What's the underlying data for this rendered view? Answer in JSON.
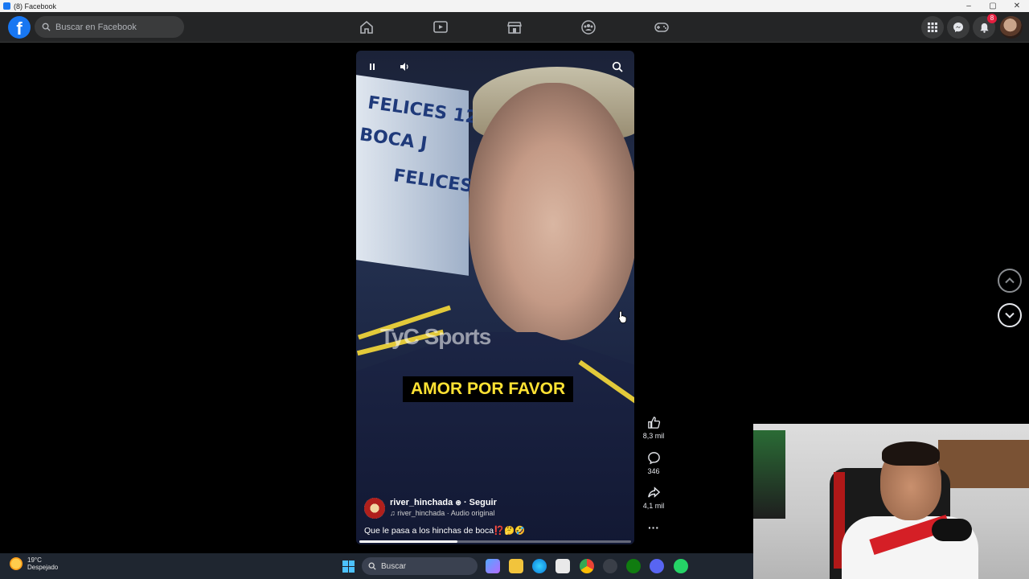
{
  "window": {
    "title": "(8) Facebook",
    "controls": [
      "–",
      "▢",
      "✕"
    ]
  },
  "topbar": {
    "search_placeholder": "Buscar en Facebook",
    "notifications_count": "8"
  },
  "video": {
    "banner_lines": [
      "FELICES 12",
      "BOCA J",
      "FELICES"
    ],
    "watermark": "TyC Sports",
    "subtitle": "AMOR POR FAVOR",
    "progress": 0.36
  },
  "post": {
    "author": "river_hinchada",
    "follow": "· Seguir",
    "audio": "river_hinchada · Audio original",
    "caption": "Que le pasa a los hinchas de boca⁉️🤔🤣"
  },
  "actions": {
    "likes": "8,3 mil",
    "comments": "346",
    "shares": "4,1 mil"
  },
  "taskbar": {
    "weather_temp": "19°C",
    "weather_desc": "Despejado",
    "search_label": "Buscar"
  }
}
